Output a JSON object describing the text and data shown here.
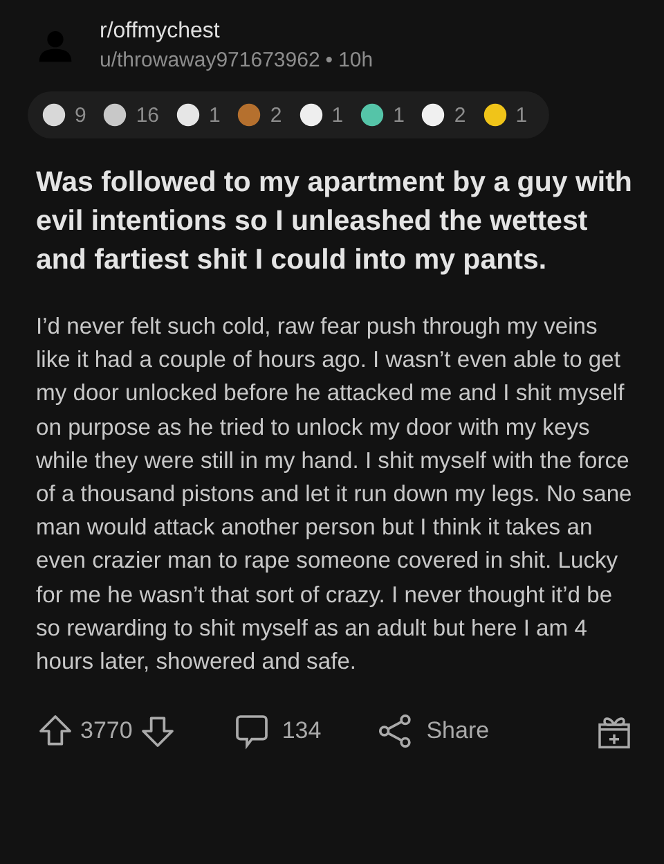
{
  "header": {
    "subreddit": "r/offmychest",
    "author": "u/throwaway971673962",
    "separator": "•",
    "time": "10h"
  },
  "awards": [
    {
      "color": "#d8d8d8",
      "count": "9"
    },
    {
      "color": "#c8c8c8",
      "count": "16"
    },
    {
      "color": "#e6e6e6",
      "count": "1"
    },
    {
      "color": "#b5702e",
      "count": "2"
    },
    {
      "color": "#eeeeee",
      "count": "1"
    },
    {
      "color": "#55c4a8",
      "count": "1"
    },
    {
      "color": "#f0f0f0",
      "count": "2"
    },
    {
      "color": "#f0c419",
      "count": "1"
    }
  ],
  "post": {
    "title": "Was followed to my apartment by a guy with evil intentions so I unleashed the wettest and fartiest shit I could into my pants.",
    "body": "I’d never felt such cold, raw fear push through my veins like it had a couple of hours ago. I wasn’t even able to get my door unlocked before he attacked me and I shit myself on purpose as he tried to unlock my door with my keys while they were still in my hand. I shit myself with the force of a thousand pistons and let it run down my legs. No sane man would attack another person but I think it takes an even crazier man to rape someone covered in shit. Lucky for me he wasn’t that sort of crazy. I never thought it’d be so rewarding to shit myself as an adult but here I am 4 hours later, showered and safe."
  },
  "actions": {
    "score": "3770",
    "comments": "134",
    "share": "Share"
  }
}
